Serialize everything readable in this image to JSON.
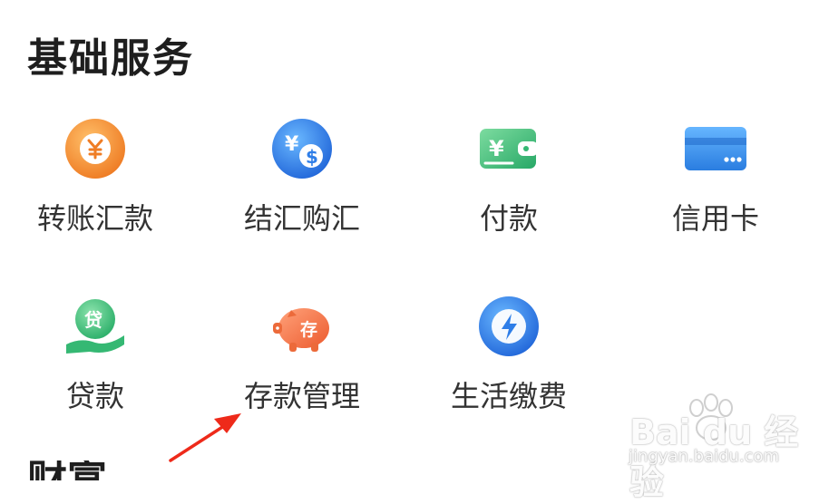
{
  "section": {
    "title": "基础服务",
    "next_title": "财富"
  },
  "services": [
    {
      "label": "转账汇款",
      "icon": "yuan-coin-icon",
      "color": "#f08a2a"
    },
    {
      "label": "结汇购汇",
      "icon": "currency-exchange-icon",
      "color": "#2f7ee8"
    },
    {
      "label": "付款",
      "icon": "wallet-payment-icon",
      "color": "#35b873"
    },
    {
      "label": "信用卡",
      "icon": "credit-card-icon",
      "color": "#3a8ee8"
    },
    {
      "label": "贷款",
      "icon": "loan-hand-icon",
      "color": "#35b873"
    },
    {
      "label": "存款管理",
      "icon": "piggy-bank-icon",
      "color": "#f06a3a"
    },
    {
      "label": "生活缴费",
      "icon": "lightning-bolt-icon",
      "color": "#2f7ee8"
    }
  ],
  "watermark": {
    "brand": "Bai du 经验",
    "url": "jingyan.baidu.com"
  }
}
